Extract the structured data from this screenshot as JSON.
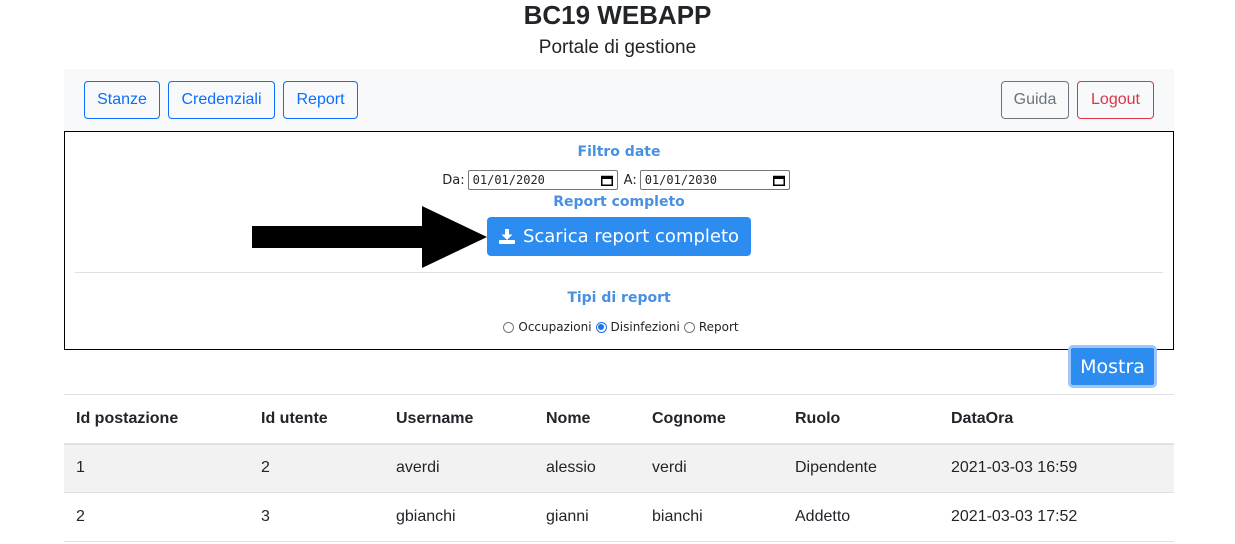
{
  "header": {
    "title": "BC19 WEBAPP",
    "subtitle": "Portale di gestione"
  },
  "nav": {
    "left": [
      "Stanze",
      "Credenziali",
      "Report"
    ],
    "guide": "Guida",
    "logout": "Logout"
  },
  "filter": {
    "title": "Filtro date",
    "from_label": "Da:",
    "from_value": "01/01/2020",
    "to_label": "A:",
    "to_value": "01/01/2030",
    "report_title": "Report completo",
    "download_label": "Scarica report completo",
    "types_title": "Tipi di report",
    "types": [
      {
        "label": "Occupazioni",
        "checked": false
      },
      {
        "label": "Disinfezioni",
        "checked": true
      },
      {
        "label": "Report",
        "checked": false
      }
    ]
  },
  "show_button": "Mostra",
  "table": {
    "headers": [
      "Id postazione",
      "Id utente",
      "Username",
      "Nome",
      "Cognome",
      "Ruolo",
      "DataOra"
    ],
    "rows": [
      [
        "1",
        "2",
        "averdi",
        "alessio",
        "verdi",
        "Dipendente",
        "2021-03-03 16:59"
      ],
      [
        "2",
        "3",
        "gbianchi",
        "gianni",
        "bianchi",
        "Addetto",
        "2021-03-03 17:52"
      ]
    ]
  },
  "colors": {
    "primary": "#2d8cf0",
    "section_label": "#4a90e2",
    "danger": "#dc3545",
    "secondary": "#6c757d"
  }
}
